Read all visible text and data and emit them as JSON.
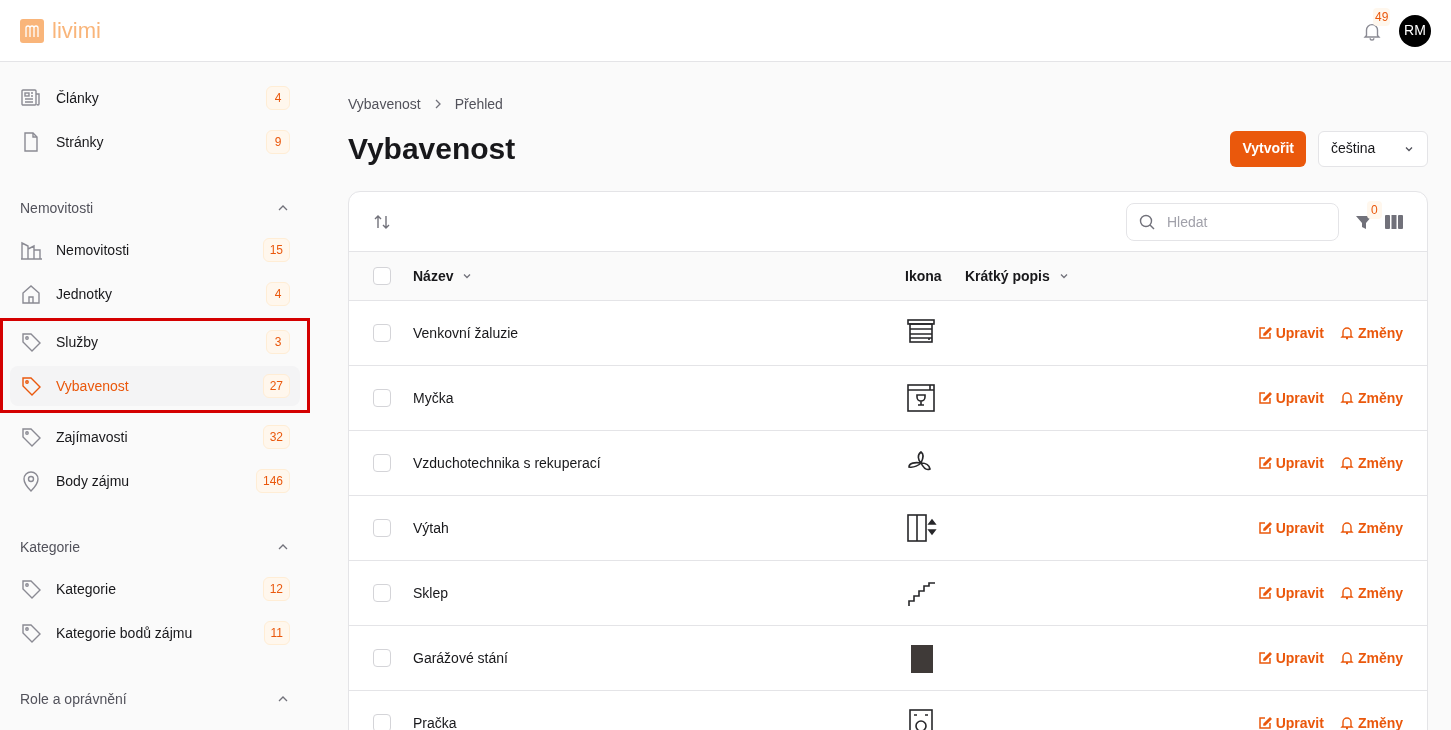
{
  "header": {
    "logo_text": "livimi",
    "notifications": "49",
    "avatar": "RM"
  },
  "sidebar": {
    "groups": [
      {
        "items": [
          {
            "kind": "news",
            "label": "Články",
            "count": "4",
            "selected": false,
            "highlighted": false
          },
          {
            "kind": "page",
            "label": "Stránky",
            "count": "9",
            "selected": false,
            "highlighted": false
          }
        ]
      },
      {
        "title": "Nemovitosti",
        "expanded": true,
        "items": [
          {
            "kind": "building",
            "label": "Nemovitosti",
            "count": "15",
            "selected": false,
            "highlighted": false
          },
          {
            "kind": "home",
            "label": "Jednotky",
            "count": "4",
            "selected": false,
            "highlighted": false
          },
          {
            "kind": "tag",
            "label": "Služby",
            "count": "3",
            "selected": false,
            "highlighted": true
          },
          {
            "kind": "tag",
            "label": "Vybavenost",
            "count": "27",
            "selected": true,
            "highlighted": true
          },
          {
            "kind": "tag",
            "label": "Zajímavosti",
            "count": "32",
            "selected": false,
            "highlighted": false
          },
          {
            "kind": "pin",
            "label": "Body zájmu",
            "count": "146",
            "selected": false,
            "highlighted": false
          }
        ]
      },
      {
        "title": "Kategorie",
        "expanded": true,
        "items": [
          {
            "kind": "tag",
            "label": "Kategorie",
            "count": "12",
            "selected": false,
            "highlighted": false
          },
          {
            "kind": "tag",
            "label": "Kategorie bodů zájmu",
            "count": "11",
            "selected": false,
            "highlighted": false
          }
        ]
      },
      {
        "title": "Role a oprávnění",
        "expanded": true
      }
    ]
  },
  "breadcrumb": [
    "Vybavenost",
    "Přehled"
  ],
  "title": "Vybavenost",
  "create_button": "Vytvořit",
  "language_select": "čeština",
  "search": {
    "placeholder": "Hledat"
  },
  "filter_count": "0",
  "table": {
    "select_all_checked": false,
    "columns": [
      {
        "label": "Název",
        "sortable": true
      },
      {
        "label": "Ikona",
        "sortable": false
      },
      {
        "label": "Krátký popis",
        "sortable": true
      }
    ],
    "rows": [
      {
        "name": "Venkovní žaluzie",
        "kind": "blind",
        "checked": false,
        "actions": [
          "Upravit",
          "Změny"
        ]
      },
      {
        "name": "Myčka",
        "kind": "dishwasher",
        "checked": false,
        "actions": [
          "Upravit",
          "Změny"
        ]
      },
      {
        "name": "Vzduchotechnika s rekuperací",
        "kind": "fan",
        "checked": false,
        "actions": [
          "Upravit",
          "Změny"
        ]
      },
      {
        "name": "Výtah",
        "kind": "elevator",
        "checked": false,
        "actions": [
          "Upravit",
          "Změny"
        ]
      },
      {
        "name": "Sklep",
        "kind": "stairs",
        "checked": false,
        "actions": [
          "Upravit",
          "Změny"
        ]
      },
      {
        "name": "Garážové stání",
        "kind": "garage",
        "checked": false,
        "actions": [
          "Upravit",
          "Změny"
        ]
      },
      {
        "name": "Pračka",
        "kind": "washer",
        "checked": false,
        "actions": [
          "Upravit",
          "Změny"
        ]
      }
    ]
  }
}
